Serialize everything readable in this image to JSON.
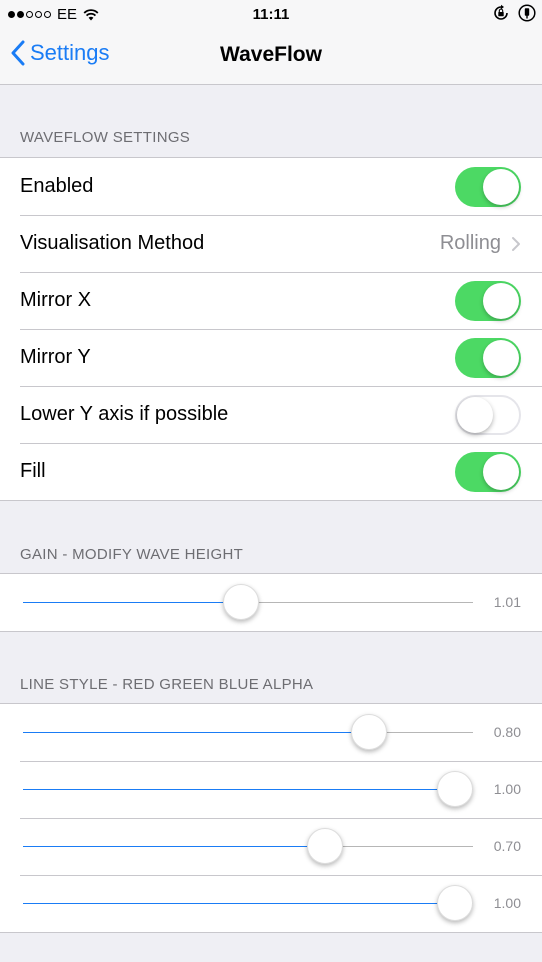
{
  "status_bar": {
    "signal_dots": [
      "full",
      "full",
      "empty",
      "empty",
      "empty"
    ],
    "carrier": "EE",
    "wifi_icon": "wifi-icon",
    "time": "11:11",
    "rotation_lock_icon": "rotation-lock-icon",
    "battery_icon": "battery-icon"
  },
  "nav": {
    "back_label": "Settings",
    "title": "WaveFlow"
  },
  "sections": {
    "waveflow": {
      "header": "WAVEFLOW SETTINGS",
      "rows": [
        {
          "label": "Enabled",
          "type": "toggle",
          "on": true
        },
        {
          "label": "Visualisation Method",
          "type": "detail",
          "value": "Rolling"
        },
        {
          "label": "Mirror X",
          "type": "toggle",
          "on": true
        },
        {
          "label": "Mirror Y",
          "type": "toggle",
          "on": true
        },
        {
          "label": "Lower Y axis if possible",
          "type": "toggle",
          "on": false
        },
        {
          "label": "Fill",
          "type": "toggle",
          "on": true
        }
      ]
    },
    "gain": {
      "header": "GAIN - MODIFY WAVE HEIGHT",
      "sliders": [
        {
          "value_label": "1.01",
          "fraction": 0.505
        }
      ]
    },
    "line_style": {
      "header": "LINE STYLE - RED GREEN BLUE ALPHA",
      "sliders": [
        {
          "value_label": "0.80",
          "fraction": 0.8
        },
        {
          "value_label": "1.00",
          "fraction": 1.0
        },
        {
          "value_label": "0.70",
          "fraction": 0.7
        },
        {
          "value_label": "1.00",
          "fraction": 1.0
        }
      ]
    }
  },
  "colors": {
    "accent": "#1a7cf5",
    "toggle_on": "#4cd964",
    "background": "#efeff4"
  }
}
